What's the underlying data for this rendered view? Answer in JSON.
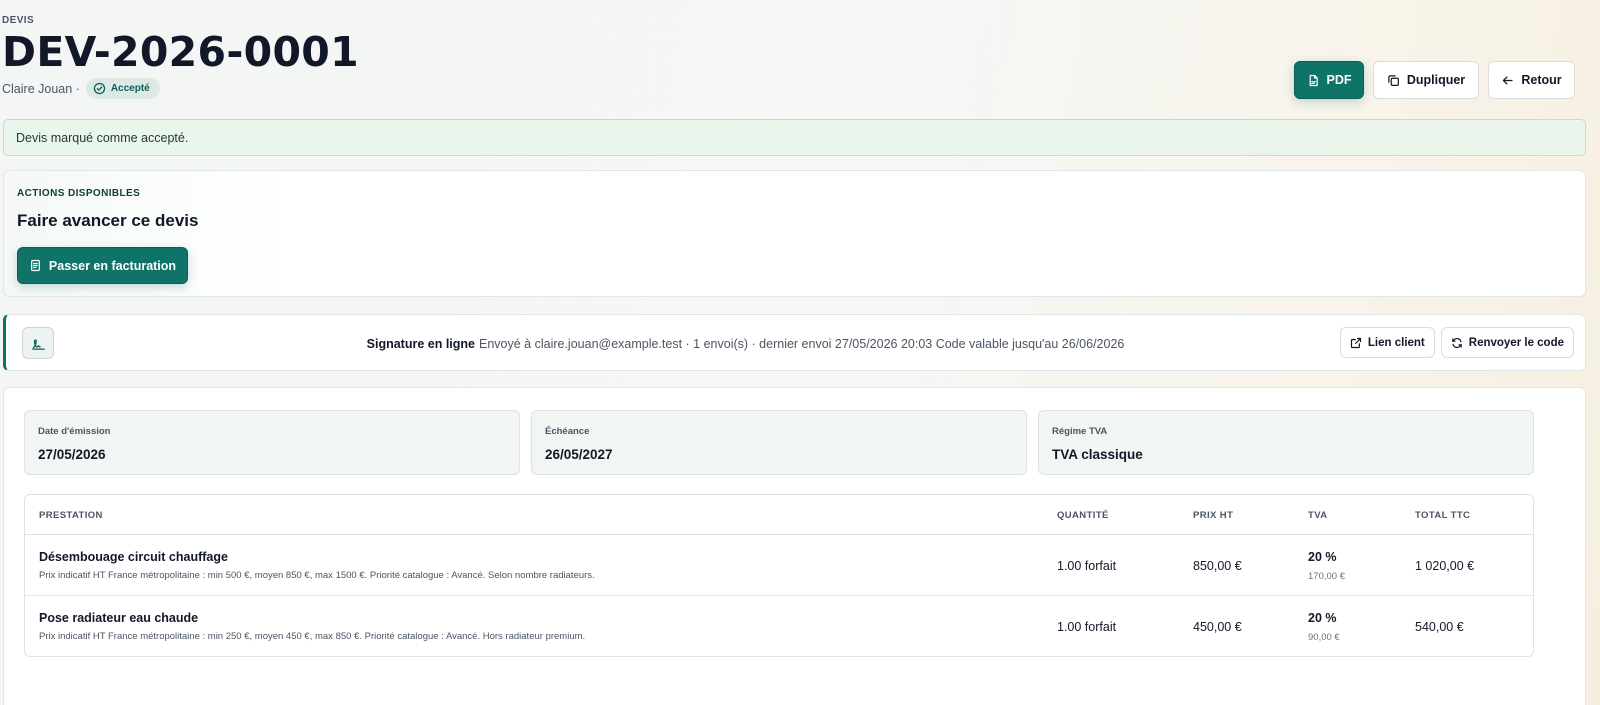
{
  "header": {
    "eyebrow": "DEVIS",
    "title": "DEV-2026-0001",
    "client": "Claire Jouan ·",
    "status": "Accepté",
    "actions": {
      "pdf": "PDF",
      "duplicate": "Dupliquer",
      "back": "Retour"
    }
  },
  "alert": {
    "message": "Devis marqué comme accepté."
  },
  "actions_card": {
    "eyebrow": "ACTIONS DISPONIBLES",
    "title": "Faire avancer ce devis",
    "invoice_button": "Passer en facturation"
  },
  "signature": {
    "label": "Signature en ligne",
    "details": "Envoyé à claire.jouan@example.test · 1 envoi(s) · dernier envoi 27/05/2026 20:03 Code valable jusqu'au 26/06/2026",
    "client_link": "Lien client",
    "resend_code": "Renvoyer le code"
  },
  "meta": [
    {
      "label": "Date d'émission",
      "value": "27/05/2026"
    },
    {
      "label": "Échéance",
      "value": "26/05/2027"
    },
    {
      "label": "Régime TVA",
      "value": "TVA classique"
    }
  ],
  "table": {
    "headers": [
      "PRESTATION",
      "QUANTITÉ",
      "PRIX HT",
      "TVA",
      "TOTAL TTC"
    ],
    "rows": [
      {
        "name": "Désembouage circuit chauffage",
        "description": "Prix indicatif HT France métropolitaine : min 500 €, moyen 850 €, max 1500 €. Priorité catalogue : Avancé. Selon nombre radiateurs.",
        "quantity": "1.00 forfait",
        "price_ht": "850,00 €",
        "vat_rate": "20 %",
        "vat_amount": "170,00 €",
        "total_ttc": "1 020,00 €"
      },
      {
        "name": "Pose radiateur eau chaude",
        "description": "Prix indicatif HT France métropolitaine : min 250 €, moyen 450 €, max 850 €. Priorité catalogue : Avancé. Hors radiateur premium.",
        "quantity": "1.00 forfait",
        "price_ht": "450,00 €",
        "vat_rate": "20 %",
        "vat_amount": "90,00 €",
        "total_ttc": "540,00 €"
      }
    ]
  },
  "colors": {
    "accent": "#0f7368",
    "success_bg": "#eaf6ec",
    "badge_bg": "#dde9e4"
  },
  "icons": {
    "pdf": "file-pdf-icon",
    "duplicate": "copy-icon",
    "back": "arrow-left-icon",
    "status": "check-circle-icon",
    "invoice": "document-icon",
    "signature": "signature-icon",
    "client_link": "external-link-icon",
    "resend": "refresh-icon"
  }
}
